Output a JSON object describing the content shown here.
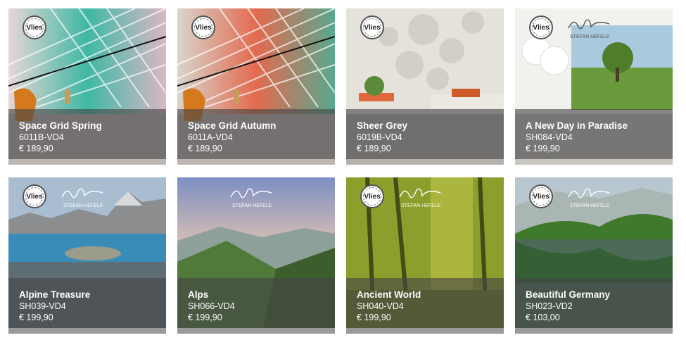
{
  "products": [
    {
      "title": "Space Grid Spring",
      "sku": "6011B-VD4",
      "price": "€ 189,90",
      "badge": "Vlies",
      "signature": false
    },
    {
      "title": "Space Grid Autumn",
      "sku": "6011A-VD4",
      "price": "€ 189,90",
      "badge": "Vlies",
      "signature": false
    },
    {
      "title": "Sheer Grey",
      "sku": "6019B-VD4",
      "price": "€ 189,90",
      "badge": "Vlies",
      "signature": false
    },
    {
      "title": "A New Day in Paradise",
      "sku": "SH084-VD4",
      "price": "€ 199,90",
      "badge": "Vlies",
      "signature": true,
      "signature_text": "STEFAN HEFELE"
    },
    {
      "title": "Alpine Treasure",
      "sku": "SH039-VD4",
      "price": "€ 199,90",
      "badge": "Vlies",
      "signature": true,
      "signature_text": "STEFAN HEFELE"
    },
    {
      "title": "Alps",
      "sku": "SH066-VD4",
      "price": "€ 199,90",
      "badge": "",
      "signature": true,
      "signature_text": "STEFAN HEFELE"
    },
    {
      "title": "Ancient World",
      "sku": "SH040-VD4",
      "price": "€ 199,90",
      "badge": "Vlies",
      "signature": true,
      "signature_text": "STEFAN HEFELE"
    },
    {
      "title": "Beautiful Germany",
      "sku": "SH023-VD2",
      "price": "€ 103,00",
      "badge": "Vlies",
      "signature": true,
      "signature_text": "STEFAN HEFELE"
    }
  ]
}
